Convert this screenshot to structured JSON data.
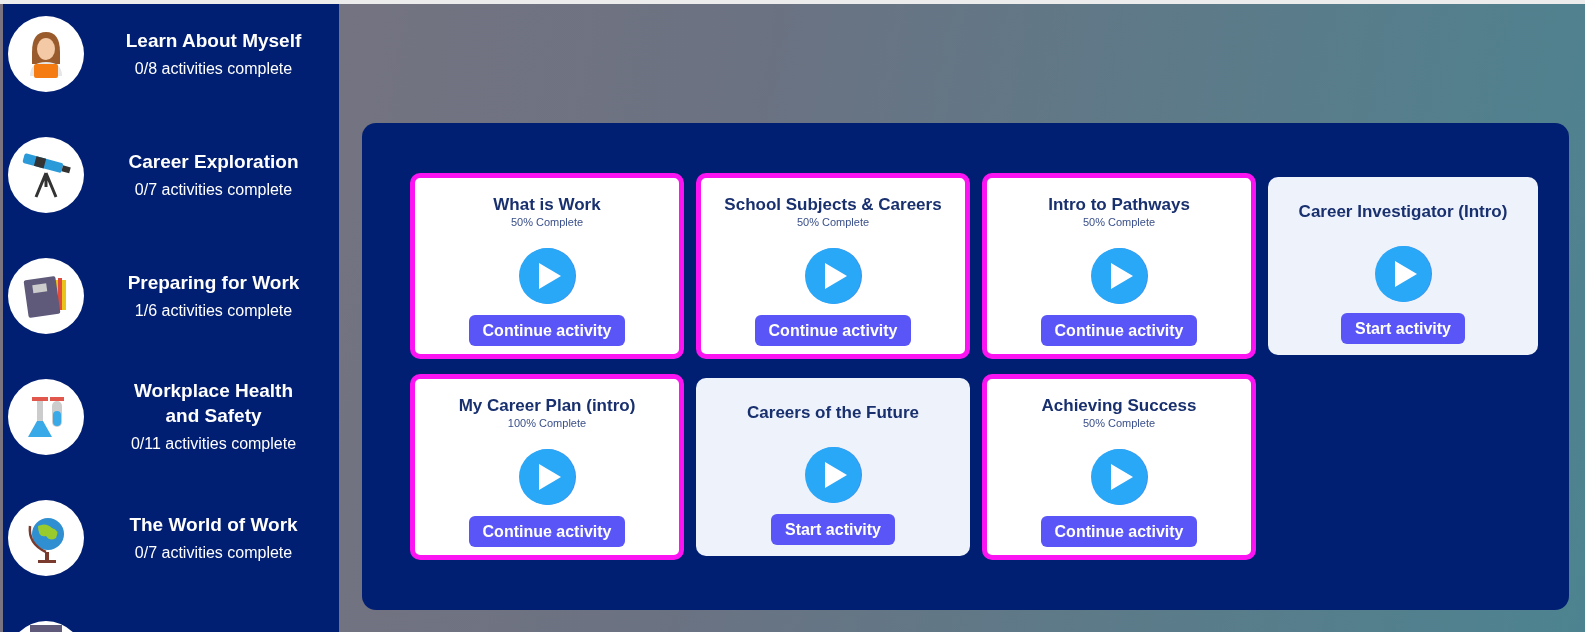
{
  "sidebar": {
    "items": [
      {
        "title": "Learn About Myself",
        "progress": "0/8 activities complete"
      },
      {
        "title": "Career Exploration",
        "progress": "0/7 activities complete"
      },
      {
        "title": "Preparing for Work",
        "progress": "1/6 activities complete"
      },
      {
        "title": "Workplace Health and Safety",
        "progress": "0/11 activities complete"
      },
      {
        "title": "The World of Work",
        "progress": "0/7 activities complete"
      }
    ]
  },
  "activities": [
    {
      "title": "What is Work",
      "percent": "50% Complete",
      "in_progress": true,
      "button": "Continue activity"
    },
    {
      "title": "School Subjects & Careers",
      "percent": "50% Complete",
      "in_progress": true,
      "button": "Continue activity"
    },
    {
      "title": "Intro to Pathways",
      "percent": "50% Complete",
      "in_progress": true,
      "button": "Continue activity"
    },
    {
      "title": "Career Investigator (Intro)",
      "in_progress": false,
      "button": "Start activity"
    },
    {
      "title": "My Career Plan (intro)",
      "percent": "100% Complete",
      "in_progress": true,
      "button": "Continue activity"
    },
    {
      "title": "Careers of the Future",
      "in_progress": false,
      "button": "Start activity"
    },
    {
      "title": "Achieving Success",
      "percent": "50% Complete",
      "in_progress": true,
      "button": "Continue activity"
    }
  ]
}
